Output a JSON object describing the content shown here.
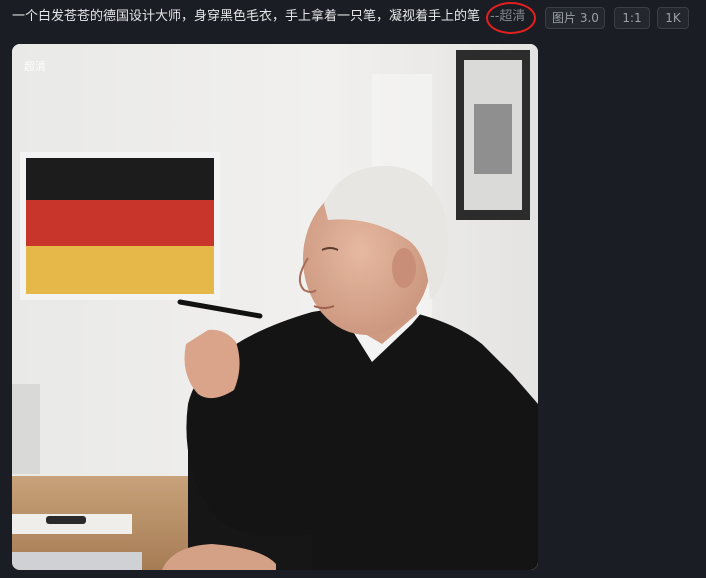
{
  "prompt": {
    "text": "一个白发苍苍的德国设计大师，身穿黑色毛衣，手上拿着一只笔，凝视着手上的笔",
    "quality_suffix": "--超清"
  },
  "params": {
    "model": "图片 3.0",
    "ratio": "1:1",
    "resolution": "1K"
  },
  "image": {
    "watermark": "超清"
  },
  "colors": {
    "background": "#1a1d23",
    "annotation_circle": "#e0201e",
    "flag_black": "#1c1c1c",
    "flag_red": "#c8352a",
    "flag_gold": "#e6b84a"
  }
}
